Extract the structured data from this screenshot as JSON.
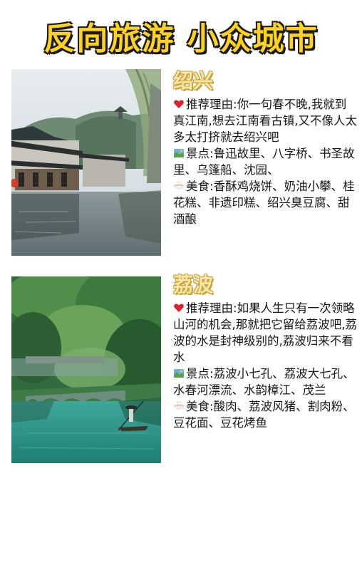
{
  "page": {
    "title": "反向旅游 小众城市"
  },
  "cards": [
    {
      "city": "绍兴",
      "reason_label": "推荐理由:",
      "reason_text": "你一句春不晚,我就到真江南,想去江南看古镇,又不像人太多太打挤就去绍兴吧",
      "sights_label": "景点:",
      "sights_text": "鲁迅故里、八字桥、书圣故里、乌篷船、沈园、",
      "food_label": "美食:",
      "food_text": "香酥鸡烧饼、奶油小攀、桂花糕、非遗印糕、绍兴臭豆腐、甜酒酿",
      "photo": "water-town-canal"
    },
    {
      "city": "荔波",
      "reason_label": "推荐理由:",
      "reason_text": "如果人生只有一次领略山河的机会,那就把它留给荔波吧,荔波的水是封神级别的,荔波归来不看水",
      "sights_label": "景点:",
      "sights_text": "荔波小七孔、荔波大七孔、水春河漂流、水韵樟江、茂兰",
      "food_label": "美食:",
      "food_text": "酸肉、荔波风猪、割肉粉、豆花面、豆花烤鱼",
      "photo": "green-river-boatman"
    }
  ],
  "icons": {
    "reason": "heart-icon",
    "sights": "map-icon",
    "food": "bowl-icon"
  },
  "colors": {
    "title": "#ffd21f",
    "title_outline": "#1a1a1a",
    "city": "#f7e7a6",
    "heart": "#e0202a"
  }
}
